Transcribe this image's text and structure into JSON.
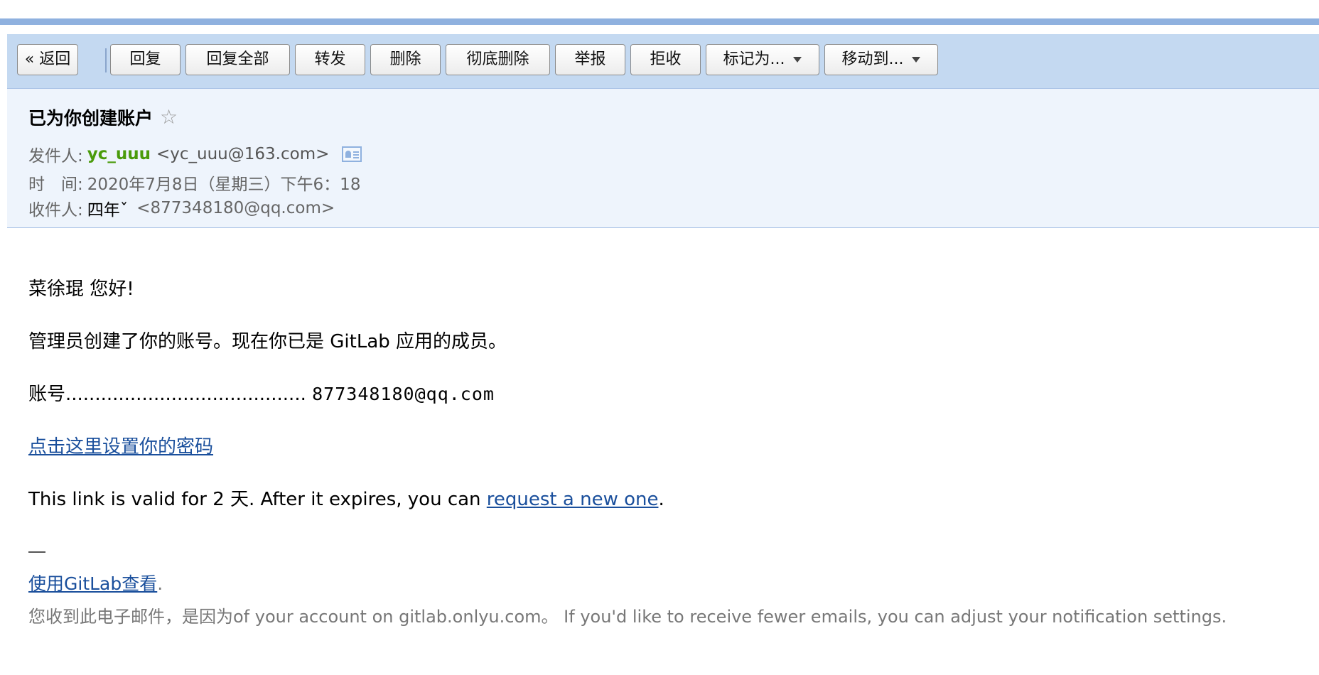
{
  "toolbar": {
    "back_label": "« 返回",
    "reply_label": "回复",
    "reply_all_label": "回复全部",
    "forward_label": "转发",
    "delete_label": "删除",
    "delete_permanently_label": "彻底删除",
    "report_label": "举报",
    "reject_label": "拒收",
    "mark_as_label": "标记为...",
    "move_to_label": "移动到..."
  },
  "email": {
    "subject": "已为你创建账户",
    "from_label": "发件人:",
    "from_name": "yc_uuu",
    "from_address": "<yc_uuu@163.com>",
    "time_label": "时　间:",
    "time_value": "2020年7月8日（星期三）下午6：18",
    "to_label": "收件人:",
    "to_name": "四年ˇ",
    "to_address": "<877348180@qq.com>"
  },
  "body": {
    "greeting": "菜徐琨 您好!",
    "intro": "管理员创建了你的账号。现在你已是 GitLab 应用的成员。",
    "account_label": "账号.........................................",
    "account_value": "877348180@qq.com",
    "set_password_link": "点击这里设置你的密码",
    "validity_prefix": "This link is valid for 2 天. After it expires, you can ",
    "request_link": "request a new one",
    "validity_suffix": ".",
    "view_link": "使用GitLab查看",
    "view_suffix": ".",
    "footer": "您收到此电子邮件，是因为of your account on gitlab.onlyu.com。 If you'd like to receive fewer emails, you can adjust your notification settings."
  },
  "colors": {
    "toolbar_bg": "#c4d9f1",
    "header_bg": "#eef4fc",
    "link": "#1a4f9c",
    "sender_name": "#4a9b0b"
  }
}
